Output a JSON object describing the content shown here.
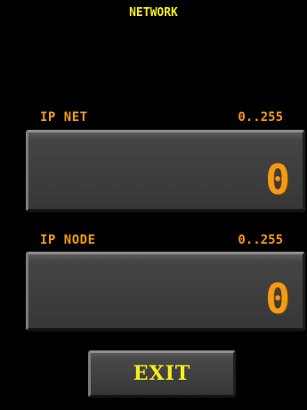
{
  "header": {
    "title": "NETWORK"
  },
  "fields": [
    {
      "label": "IP NET",
      "range": "0..255",
      "value": "0"
    },
    {
      "label": "IP NODE",
      "range": "0..255",
      "value": "0"
    }
  ],
  "buttons": {
    "exit_label": "EXIT"
  },
  "colors": {
    "background": "#000000",
    "title": "#f6ee1c",
    "label": "#f59a13",
    "value": "#f59a13",
    "button_text": "#f6ee1c",
    "field_background": "#3d3d3d"
  }
}
